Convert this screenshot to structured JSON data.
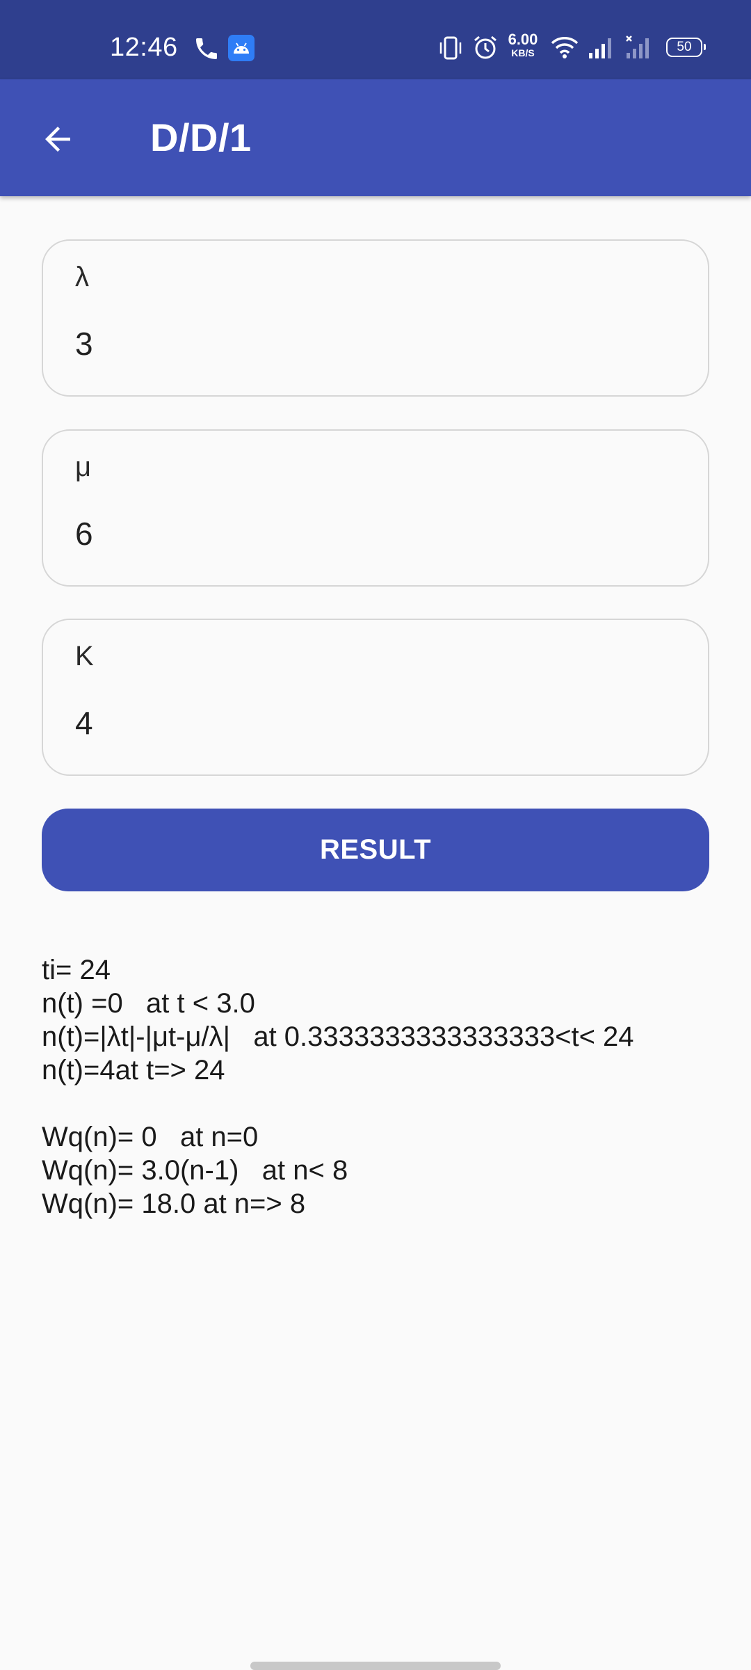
{
  "status_bar": {
    "time": "12:46",
    "net_speed_value": "6.00",
    "net_speed_unit": "KB/S",
    "battery": "50",
    "color": "#2f3f8e"
  },
  "app_bar": {
    "title": "D/D/1",
    "color": "#3f51b5",
    "back_icon": "arrow-back-icon"
  },
  "fields": [
    {
      "label": "λ",
      "value": "3"
    },
    {
      "label": "μ",
      "value": "6"
    },
    {
      "label": "K",
      "value": "4"
    }
  ],
  "result_button": {
    "label": "RESULT"
  },
  "results": {
    "line1": "ti= 24",
    "line2": "n(t) =0   at t < 3.0",
    "line3": "n(t)=|λt|-|μt-μ/λ|   at 0.3333333333333333<t< 24",
    "line4": "n(t)=4at t=> 24",
    "line5": "Wq(n)= 0   at n=0",
    "line6": "Wq(n)= 3.0(n-1)   at n< 8",
    "line7": "Wq(n)= 18.0 at n=> 8"
  }
}
